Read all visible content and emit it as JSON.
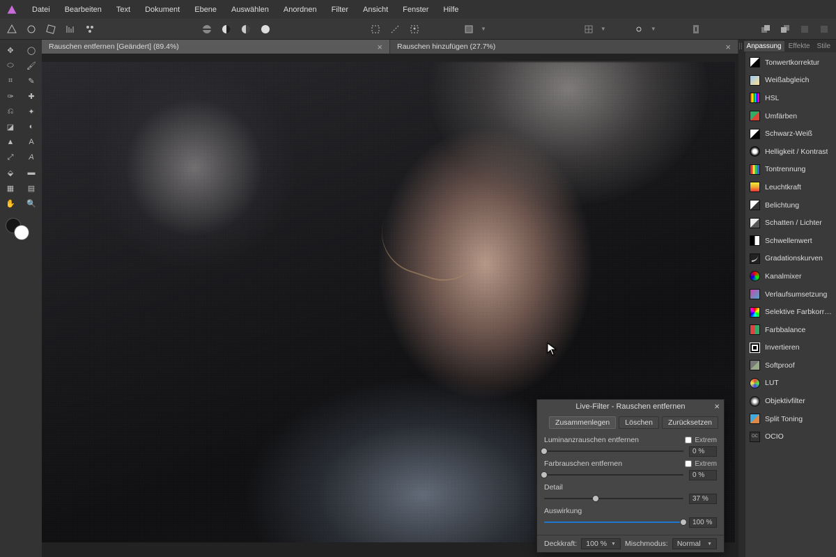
{
  "menu": [
    "Datei",
    "Bearbeiten",
    "Text",
    "Dokument",
    "Ebene",
    "Auswählen",
    "Anordnen",
    "Filter",
    "Ansicht",
    "Fenster",
    "Hilfe"
  ],
  "doctabs": [
    {
      "label": "Rauschen entfernen [Geändert] (89.4%)",
      "active": true
    },
    {
      "label": "Rauschen hinzufügen (27.7%)",
      "active": false
    }
  ],
  "panel_tabs": {
    "adjust": "Anpassung",
    "effects": "Effekte",
    "styles": "Stile"
  },
  "adjustments": [
    {
      "label": "Tonwertkorrektur",
      "icon": "i-levels"
    },
    {
      "label": "Weißabgleich",
      "icon": "i-wb"
    },
    {
      "label": "HSL",
      "icon": "i-hsl"
    },
    {
      "label": "Umfärben",
      "icon": "i-recolor"
    },
    {
      "label": "Schwarz-Weiß",
      "icon": "i-bw"
    },
    {
      "label": "Helligkeit / Kontrast",
      "icon": "i-bc"
    },
    {
      "label": "Tontrennung",
      "icon": "i-post"
    },
    {
      "label": "Leuchtkraft",
      "icon": "i-vib"
    },
    {
      "label": "Belichtung",
      "icon": "i-exp"
    },
    {
      "label": "Schatten / Lichter",
      "icon": "i-sh"
    },
    {
      "label": "Schwellenwert",
      "icon": "i-thr"
    },
    {
      "label": "Gradationskurven",
      "icon": "i-curves"
    },
    {
      "label": "Kanalmixer",
      "icon": "i-mixer"
    },
    {
      "label": "Verlaufsumsetzung",
      "icon": "i-grad"
    },
    {
      "label": "Selektive Farbkorrektur",
      "icon": "i-sel"
    },
    {
      "label": "Farbbalance",
      "icon": "i-bal"
    },
    {
      "label": "Invertieren",
      "icon": "i-inv"
    },
    {
      "label": "Softproof",
      "icon": "i-soft"
    },
    {
      "label": "LUT",
      "icon": "i-lut"
    },
    {
      "label": "Objektivfilter",
      "icon": "i-lens"
    },
    {
      "label": "Split Toning",
      "icon": "i-split"
    },
    {
      "label": "OCIO",
      "icon": "i-ocio"
    }
  ],
  "dialog": {
    "title": "Live-Filter - Rauschen entfernen",
    "buttons": {
      "merge": "Zusammenlegen",
      "delete": "Löschen",
      "reset": "Zurücksetzen"
    },
    "params": {
      "lum": {
        "label": "Luminanzrauschen entfernen",
        "extreme": "Extrem",
        "value": "0 %",
        "pct": 0
      },
      "col": {
        "label": "Farbrauschen entfernen",
        "extreme": "Extrem",
        "value": "0 %",
        "pct": 0
      },
      "det": {
        "label": "Detail",
        "value": "37 %",
        "pct": 37
      },
      "con": {
        "label": "Auswirkung",
        "value": "100 %",
        "pct": 100
      }
    },
    "footer": {
      "opacity_label": "Deckkraft:",
      "opacity_value": "100 %",
      "blend_label": "Mischmodus:",
      "blend_value": "Normal"
    }
  }
}
